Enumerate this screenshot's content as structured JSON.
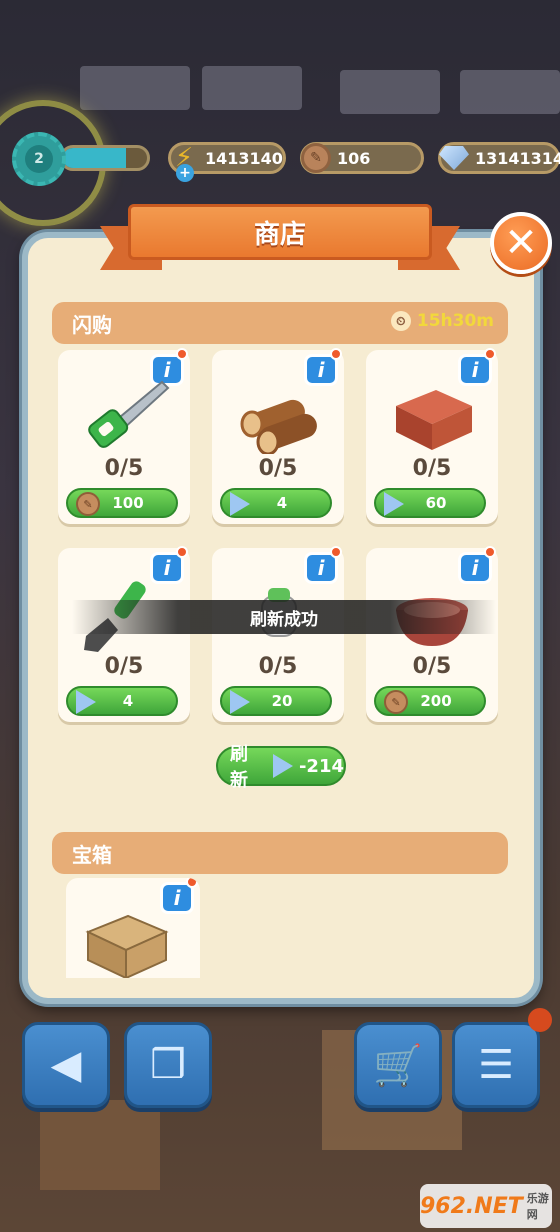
{
  "topbar": {
    "level": "2",
    "level_progress": 0.75,
    "energy": "1413140",
    "coins": "106",
    "gems": "13141314"
  },
  "shop": {
    "title": "商店",
    "flash_sale": {
      "label": "闪购",
      "timer": "15h30m"
    },
    "items": [
      {
        "name": "saw",
        "count": "0/5",
        "price": "100",
        "currency": "coin"
      },
      {
        "name": "logs",
        "count": "0/5",
        "price": "4",
        "currency": "gem"
      },
      {
        "name": "wood-block",
        "count": "0/5",
        "price": "60",
        "currency": "gem"
      },
      {
        "name": "shovel",
        "count": "0/5",
        "price": "4",
        "currency": "gem"
      },
      {
        "name": "gloves",
        "count": "0/5",
        "price": "20",
        "currency": "gem"
      },
      {
        "name": "bowl",
        "count": "0/5",
        "price": "200",
        "currency": "coin"
      }
    ],
    "toast": "刷新成功",
    "refresh": {
      "label": "刷新",
      "cost": "-214"
    },
    "chest_section": {
      "label": "宝箱"
    }
  },
  "watermark": {
    "main": "962.NET",
    "sub": "乐游网"
  }
}
